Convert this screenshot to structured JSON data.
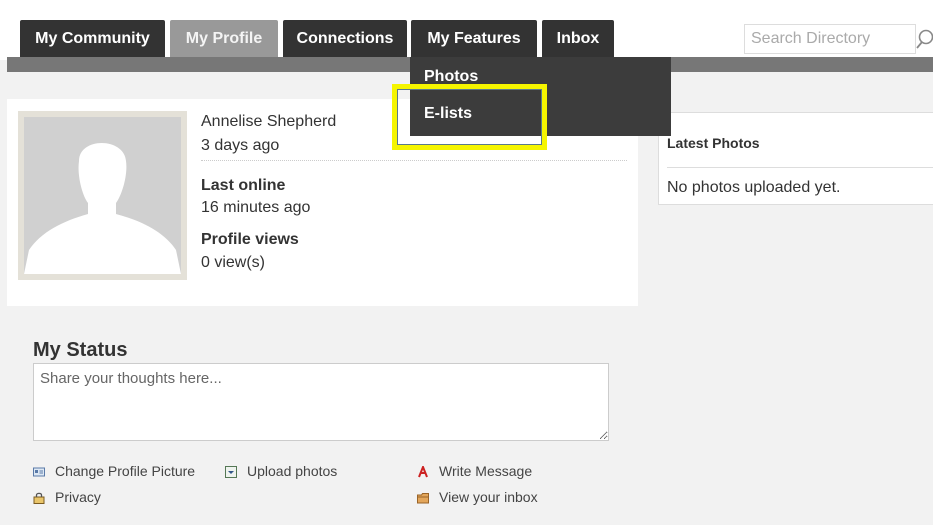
{
  "nav": {
    "tabs": [
      {
        "label": "My Community"
      },
      {
        "label": "My Profile"
      },
      {
        "label": "Connections"
      },
      {
        "label": "My Features"
      },
      {
        "label": "Inbox"
      }
    ],
    "active_tab": "My Profile"
  },
  "search": {
    "placeholder": "Search Directory"
  },
  "dropdown": {
    "items": [
      {
        "label": "Photos"
      },
      {
        "label": "E-lists"
      }
    ],
    "highlighted": "E-lists"
  },
  "profile": {
    "name": "Annelise Shepherd",
    "joined": "3 days ago",
    "last_online_label": "Last online",
    "last_online_value": "16 minutes ago",
    "views_label": "Profile views",
    "views_value": "0 view(s)"
  },
  "status": {
    "title": "My Status",
    "placeholder": "Share your thoughts here..."
  },
  "actions": {
    "change_picture": "Change Profile Picture",
    "upload_photos": "Upload photos",
    "write_message": "Write Message",
    "privacy": "Privacy",
    "view_inbox": "View your inbox"
  },
  "latest_photos": {
    "title": "Latest Photos",
    "empty": "No photos uploaded yet."
  },
  "colors": {
    "tab_bg": "#333333",
    "tab_active_bg": "#999999",
    "dropdown_bg": "#3c3c3c",
    "highlight": "#f5f500"
  }
}
